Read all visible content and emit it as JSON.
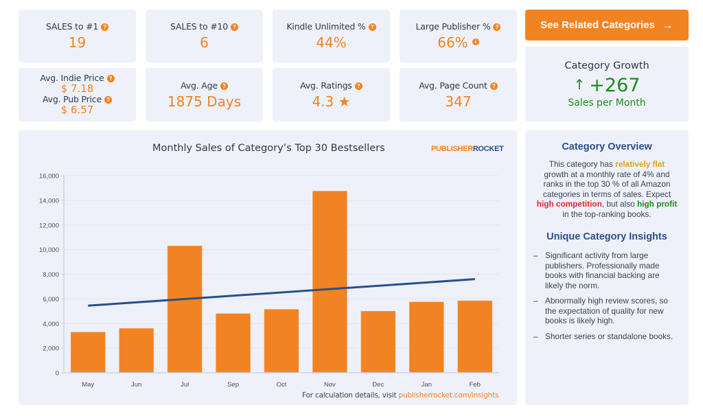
{
  "stats_row1": [
    {
      "label": "SALES to #1",
      "value": "19",
      "help_icon": "question-circle-icon"
    },
    {
      "label": "SALES to #10",
      "value": "6",
      "help_icon": "question-circle-icon"
    },
    {
      "label": "Kindle Unlimited %",
      "value": "44%",
      "help_icon": "question-circle-icon"
    },
    {
      "label": "Large Publisher %",
      "value": "66%",
      "help_icon": "question-circle-icon",
      "value_icon": "info-circle-icon"
    }
  ],
  "price_card": {
    "indie_label": "Avg. Indie Price",
    "indie_value": "$ 7.18",
    "pub_label": "Avg. Pub Price",
    "pub_value": "$ 6.57"
  },
  "stats_row2": [
    {
      "label": "Avg. Age",
      "value": "1875 Days"
    },
    {
      "label": "Avg. Ratings",
      "value": "4.3 ★"
    },
    {
      "label": "Avg. Page Count",
      "value": "347"
    }
  ],
  "icons": {
    "help": "?",
    "info": "i",
    "arrow_right": "→",
    "arrow_up": "↑"
  },
  "related_button": {
    "label": "See Related Categories"
  },
  "growth": {
    "title": "Category Growth",
    "value": "+267",
    "subtitle": "Sales per Month"
  },
  "chart_panel": {
    "brand_part1": "PUBLISHER",
    "brand_part2": "ROCKET",
    "note_prefix": "For calculation details, visit ",
    "note_link": "publisherrocket.com/insights"
  },
  "colors": {
    "accent": "#f28322",
    "trend": "#2a4f8a",
    "positive": "#1e8a1e",
    "card_bg": "#eef1f9"
  },
  "chart_data": {
    "type": "bar",
    "title": "Monthly Sales of Category’s Top 30 Bestsellers",
    "categories": [
      "May",
      "Jun",
      "Jul",
      "Sep",
      "Oct",
      "Nov",
      "Dec",
      "Jan",
      "Feb"
    ],
    "values": [
      3300,
      3600,
      10300,
      4800,
      5150,
      14750,
      5000,
      5750,
      5850
    ],
    "trendline": {
      "start": 5450,
      "end": 7600
    },
    "ylim": [
      0,
      16000
    ],
    "yticks": [
      0,
      2000,
      4000,
      6000,
      8000,
      10000,
      12000,
      14000,
      16000
    ],
    "ytick_labels": [
      "0",
      "2,000",
      "4,000",
      "6,000",
      "8,000",
      "10,000",
      "12,000",
      "14,000",
      "16,000"
    ],
    "xlabel": "",
    "ylabel": "",
    "grid": true,
    "legend": "none"
  },
  "overview": {
    "title": "Category Overview",
    "p1": "This category has ",
    "flat": "relatively flat",
    "p2": " growth at a monthly rate of 4% and ranks in the top 30 % of all Amazon categories in terms of sales. Expect ",
    "competition": "high competition",
    "p3": ", but also ",
    "profit": "high profit",
    "p4": " in the top-ranking books."
  },
  "insights": {
    "title": "Unique Category Insights",
    "items": [
      "Significant activity from large publishers. Professionally made books with financial backing are likely the norm.",
      "Abnormally high review scores, so the expectation of quality for new books is likely high.",
      "Shorter series or standalone books."
    ],
    "bullet": "–"
  }
}
